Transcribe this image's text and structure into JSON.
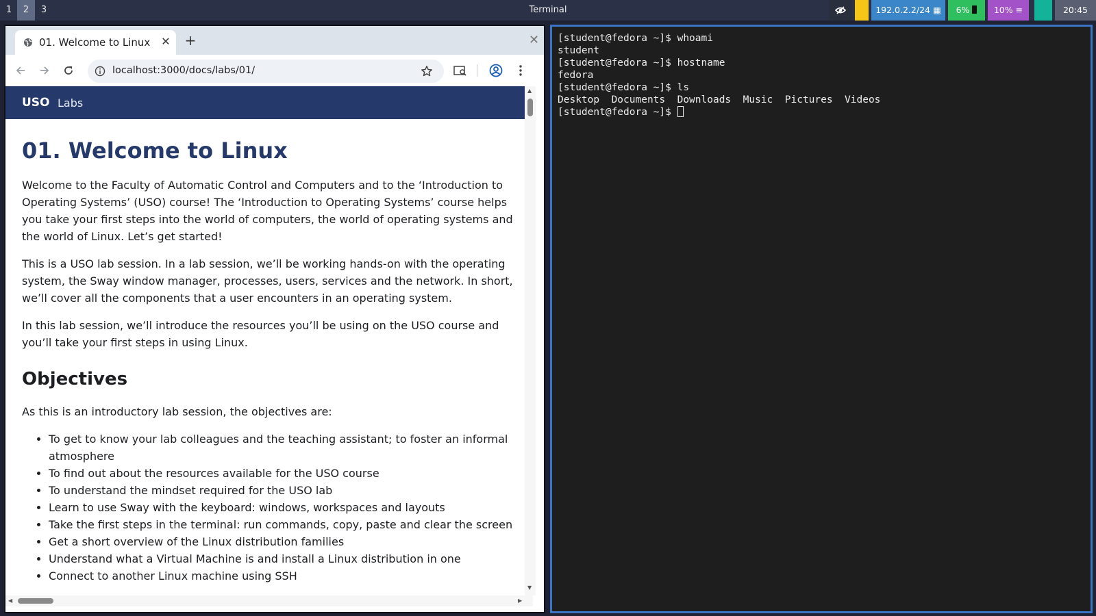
{
  "topbar": {
    "workspaces": [
      "1",
      "2",
      "3"
    ],
    "active_workspace": "2",
    "window_title": "Terminal",
    "network": "192.0.2.2/24",
    "battery": "6%",
    "cpu": "10%",
    "clock": "20:45",
    "colors": {
      "bar": "#2b3247",
      "network": "#3a86c8",
      "battery": "#2fbf5f",
      "cpu": "#a352c8",
      "yellow": "#f5c518",
      "teal": "#13b39a"
    }
  },
  "browser": {
    "tab_title": "01. Welcome to Linux",
    "url": "localhost:3000/docs/labs/01/",
    "site": {
      "brand": "USO",
      "nav_link": "Labs"
    },
    "heading": "01. Welcome to Linux",
    "paragraphs": [
      "Welcome to the Faculty of Automatic Control and Computers and to the ‘Introduction to Operating Systems’ (USO) course! The ‘Introduction to Operating Systems’ course helps you take your first steps into the world of computers, the world of operating systems and the world of Linux. Let’s get started!",
      "This is a USO lab session. In a lab session, we’ll be working hands-on with the operating system, the Sway window manager, processes, users, services and the network. In short, we’ll cover all the components that a user encounters in an operating system.",
      "In this lab session, we’ll introduce the resources you’ll be using on the USO course and you’ll take your first steps in using Linux."
    ],
    "objectives_heading": "Objectives",
    "objectives_intro": "As this is an introductory lab session, the objectives are:",
    "objectives": [
      "To get to know your lab colleagues and the teaching assistant; to foster an informal atmosphere",
      "To find out about the resources available for the USO course",
      "To understand the mindset required for the USO lab",
      "Learn to use Sway with the keyboard: windows, workspaces and layouts",
      "Take the first steps in the terminal: run commands, copy, paste and clear the screen",
      "Get a short overview of the Linux distribution families",
      "Understand what a Virtual Machine is and install a Linux distribution in one",
      "Connect to another Linux machine using SSH"
    ]
  },
  "terminal": {
    "lines": [
      "[student@fedora ~]$ whoami",
      "student",
      "[student@fedora ~]$ hostname",
      "fedora",
      "[student@fedora ~]$ ls",
      "Desktop  Documents  Downloads  Music  Pictures  Videos"
    ],
    "prompt": "[student@fedora ~]$ "
  }
}
